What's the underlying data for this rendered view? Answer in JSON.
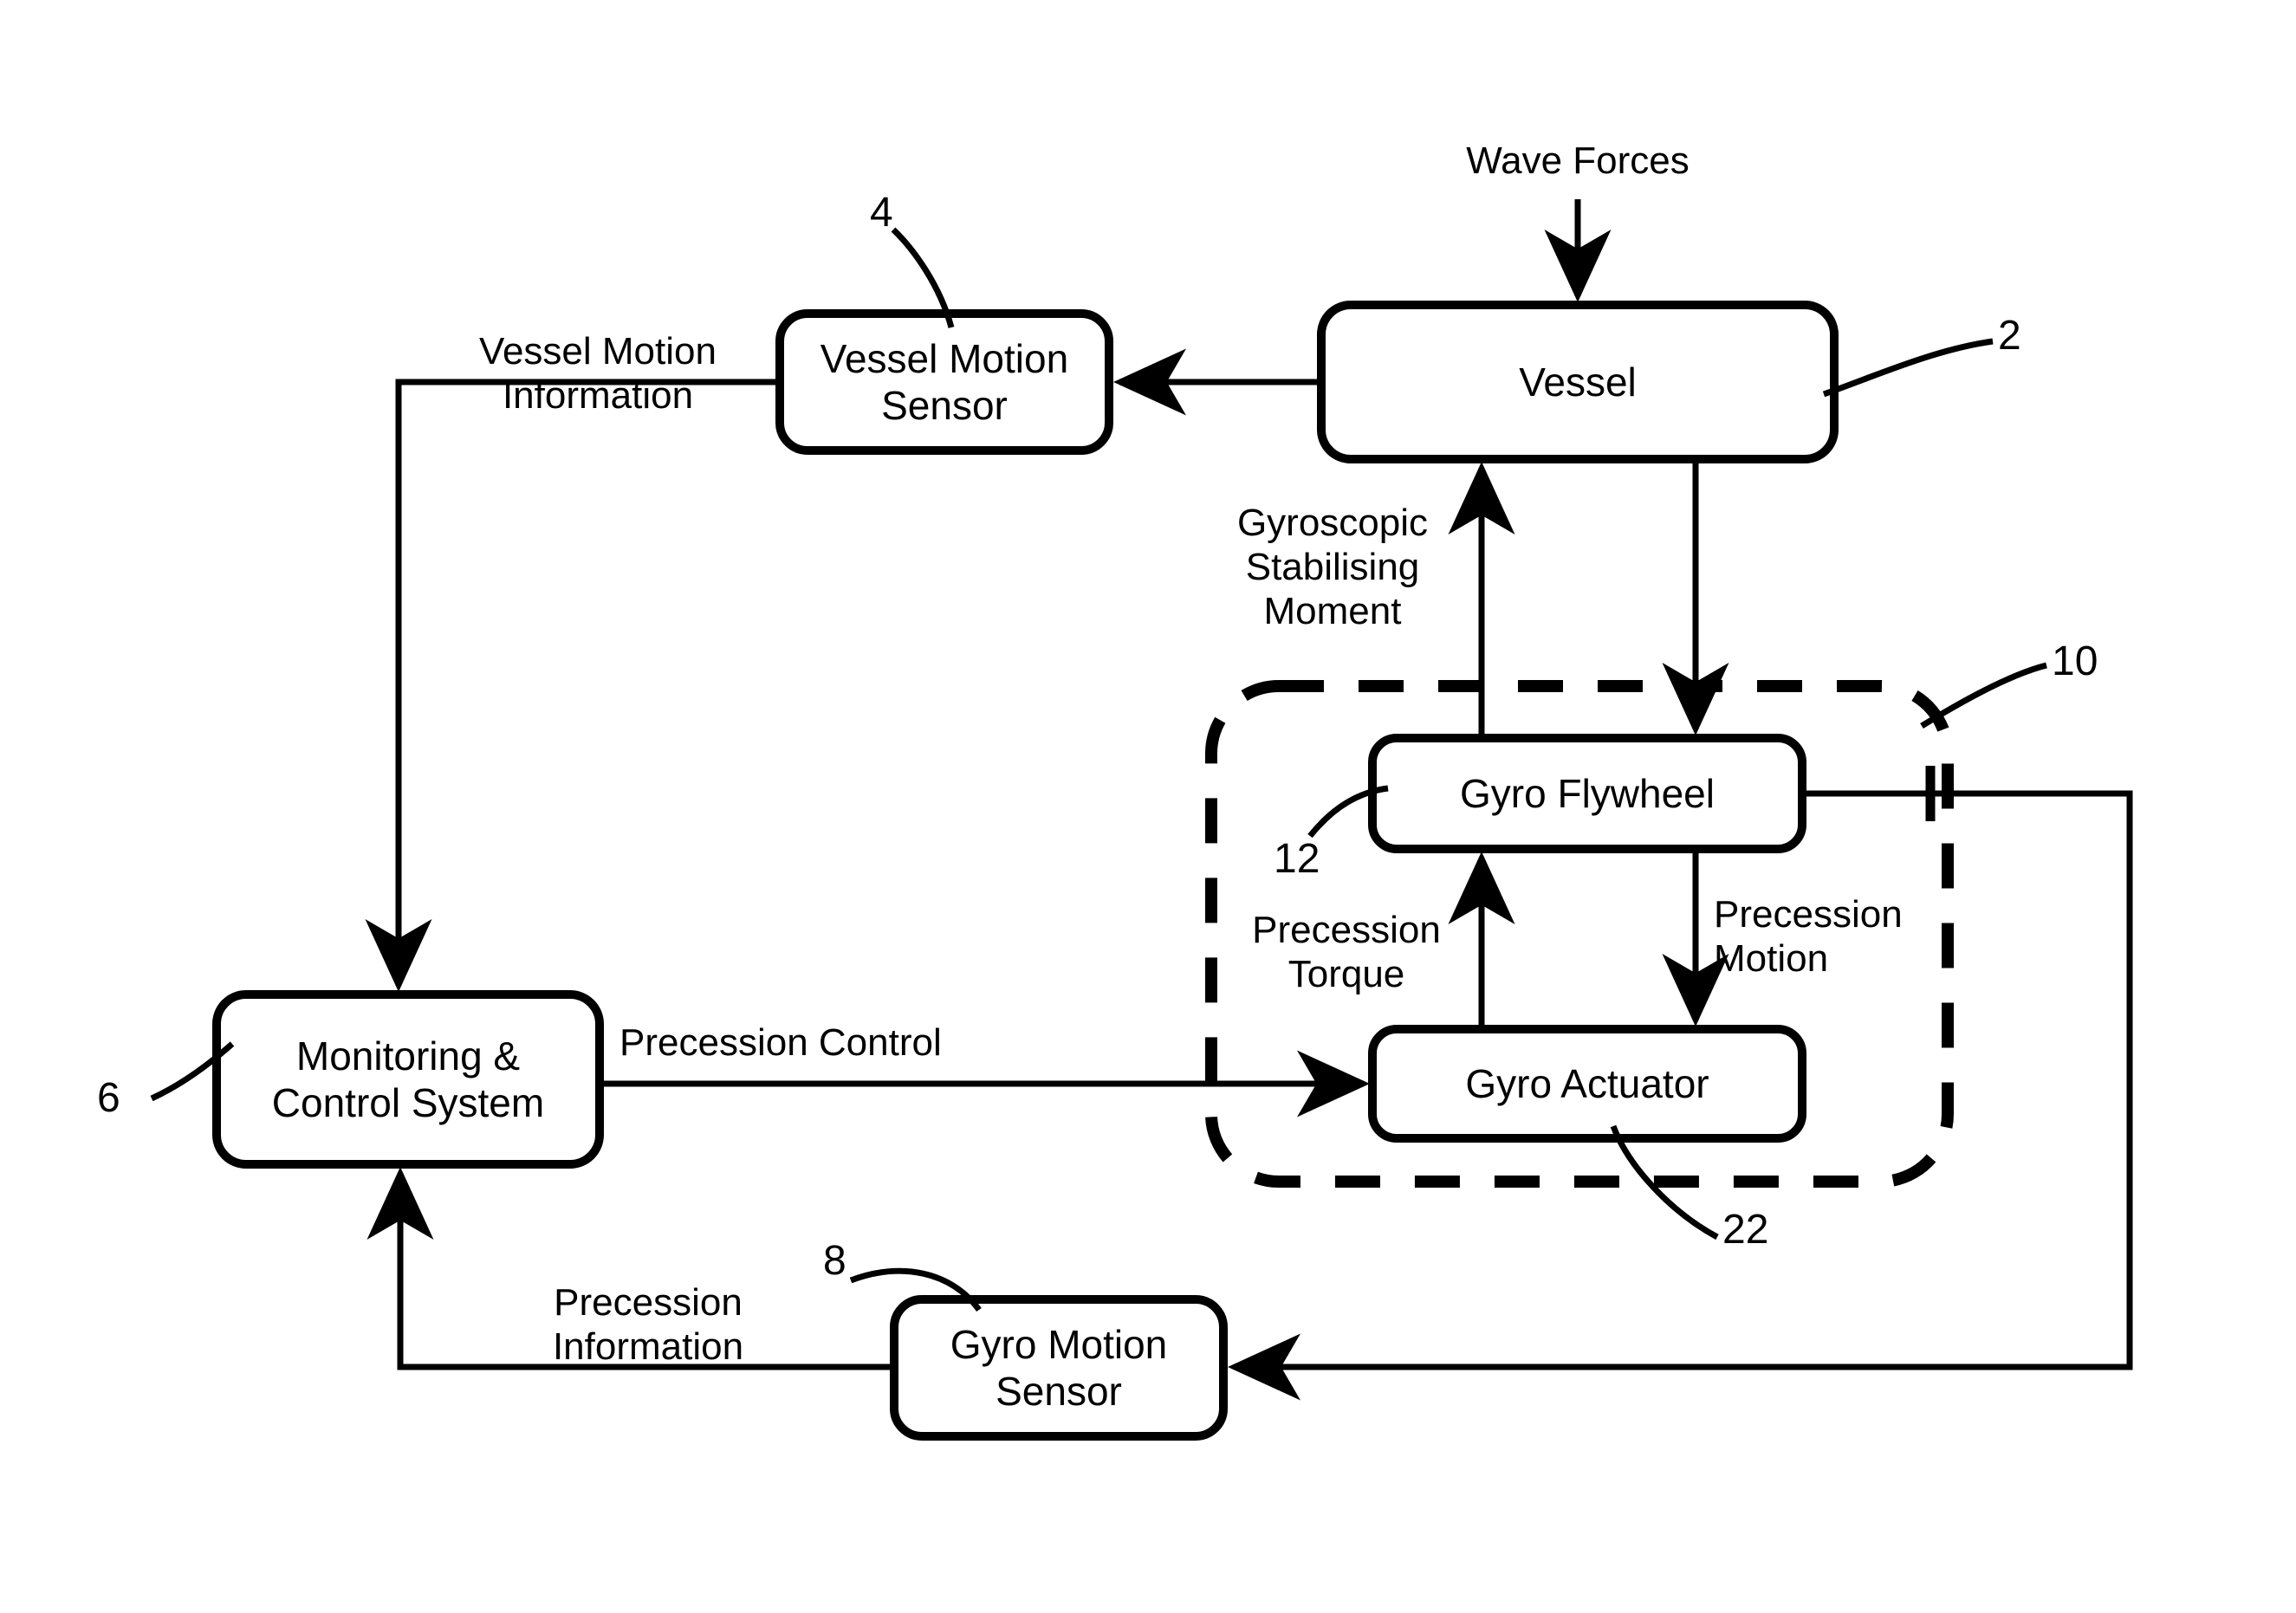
{
  "diagram": {
    "title": "Gyroscopic Vessel Stabilisation Control Block Diagram",
    "type": "block-diagram",
    "background_color": "#ffffff",
    "line_color": "#000000"
  },
  "nodes": [
    {
      "id": "vessel",
      "label": "Vessel",
      "ref": "2"
    },
    {
      "id": "vessel_motion_sensor",
      "label": "Vessel Motion\nSensor",
      "ref": "4"
    },
    {
      "id": "monitoring_control",
      "label": "Monitoring &\nControl System",
      "ref": "6"
    },
    {
      "id": "gyro_motion_sensor",
      "label": "Gyro Motion\nSensor",
      "ref": "8"
    },
    {
      "id": "gyro_flywheel",
      "label": "Gyro Flywheel",
      "ref": "12"
    },
    {
      "id": "gyro_actuator",
      "label": "Gyro Actuator",
      "ref": "22"
    }
  ],
  "groups": [
    {
      "id": "gyro_stabiliser_group",
      "label": "",
      "ref": "10",
      "style": "dashed-rounded"
    }
  ],
  "edge_labels": {
    "wave_forces": "Wave Forces",
    "vessel_motion_information": "Vessel Motion\nInformation",
    "gyroscopic_stabilising_moment": "Gyroscopic\nStabilising\nMoment",
    "precession_control": "Precession Control",
    "precession_torque": "Precession\nTorque",
    "precession_motion": "Precession\nMotion",
    "precession_information": "Precession\nInformation"
  },
  "reference_numerals": {
    "vessel": "2",
    "vessel_motion_sensor": "4",
    "monitoring_control_system": "6",
    "gyro_motion_sensor": "8",
    "gyro_stabiliser_assembly": "10",
    "gyro_flywheel": "12",
    "gyro_actuator": "22"
  },
  "edges": [
    {
      "from": "wave_forces_input",
      "to": "vessel",
      "label_key": "wave_forces",
      "direction": "down"
    },
    {
      "from": "vessel",
      "to": "vessel_motion_sensor",
      "label_key": "",
      "direction": "left"
    },
    {
      "from": "vessel_motion_sensor",
      "to": "monitoring_control",
      "label_key": "vessel_motion_information",
      "direction": "left-down"
    },
    {
      "from": "vessel",
      "to": "gyro_flywheel",
      "label_key": "",
      "direction": "down"
    },
    {
      "from": "gyro_flywheel",
      "to": "vessel",
      "label_key": "gyroscopic_stabilising_moment",
      "direction": "up"
    },
    {
      "from": "monitoring_control",
      "to": "gyro_actuator",
      "label_key": "precession_control",
      "direction": "right"
    },
    {
      "from": "gyro_actuator",
      "to": "gyro_flywheel",
      "label_key": "precession_torque",
      "direction": "up"
    },
    {
      "from": "gyro_flywheel",
      "to": "gyro_actuator",
      "label_key": "precession_motion",
      "direction": "down"
    },
    {
      "from": "gyro_flywheel",
      "to": "gyro_motion_sensor",
      "label_key": "",
      "direction": "right-down-left"
    },
    {
      "from": "gyro_motion_sensor",
      "to": "monitoring_control",
      "label_key": "precession_information",
      "direction": "left-up"
    }
  ]
}
